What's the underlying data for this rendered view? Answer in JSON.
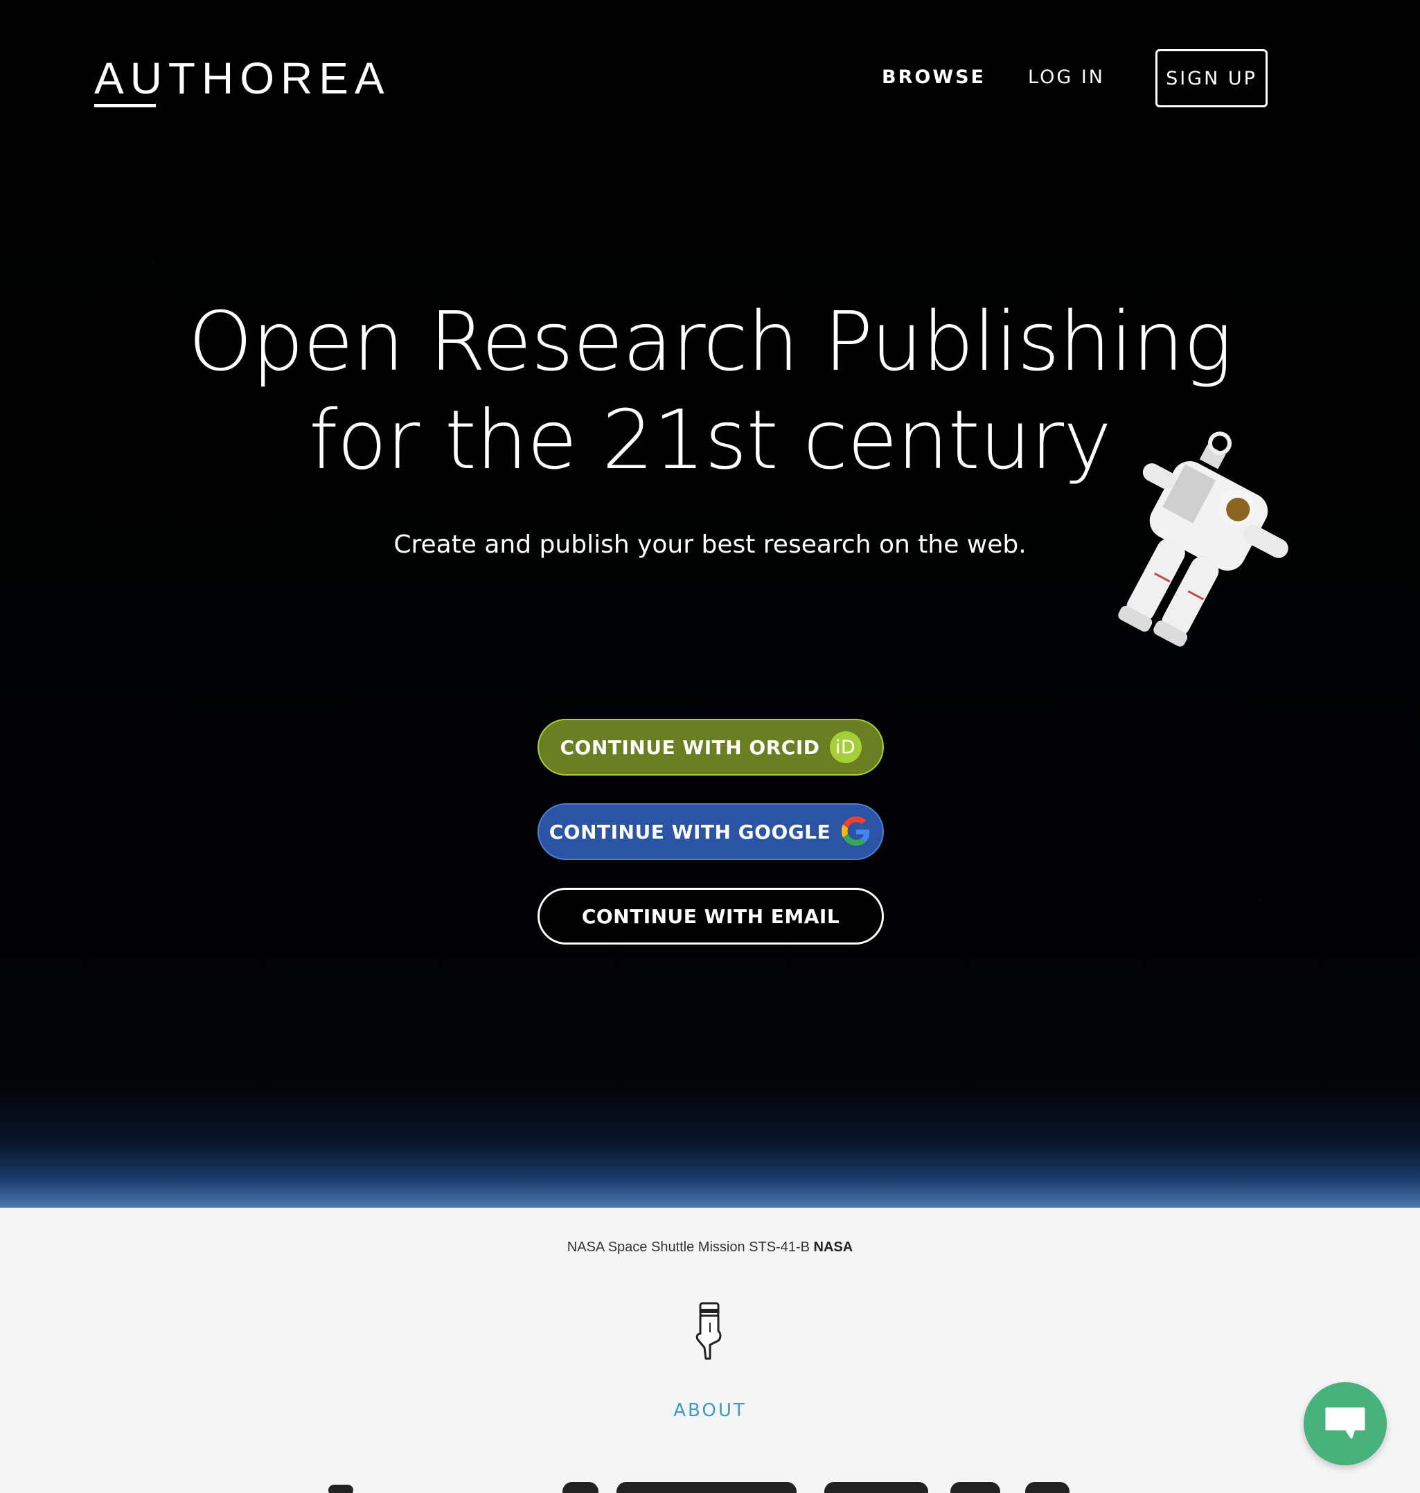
{
  "header": {
    "logo": "AUTHOREA",
    "nav": {
      "browse": "BROWSE",
      "login": "LOG IN",
      "signup": "SIGN UP"
    }
  },
  "hero": {
    "headline_line1": "Open Research Publishing",
    "headline_line2": "for the 21st century",
    "subhead": "Create and publish your best research on the web.",
    "buttons": {
      "orcid": "CONTINUE WITH ORCID",
      "orcid_icon_text": "iD",
      "google": "CONTINUE WITH GOOGLE",
      "email": "CONTINUE WITH EMAIL"
    }
  },
  "credit": {
    "caption": "NASA Space Shuttle Mission STS-41-B",
    "source": "NASA"
  },
  "section": {
    "about_label": "ABOUT"
  },
  "colors": {
    "orcid_button": "#6a7e22",
    "google_button": "#2b55a4",
    "about_link": "#3b9cc7",
    "chat_button": "#47b27b"
  },
  "icons": {
    "orcid": "orcid-id-icon",
    "google": "google-g-icon",
    "pointer": "pointing-hand-icon",
    "chat": "chat-bubble-icon"
  }
}
